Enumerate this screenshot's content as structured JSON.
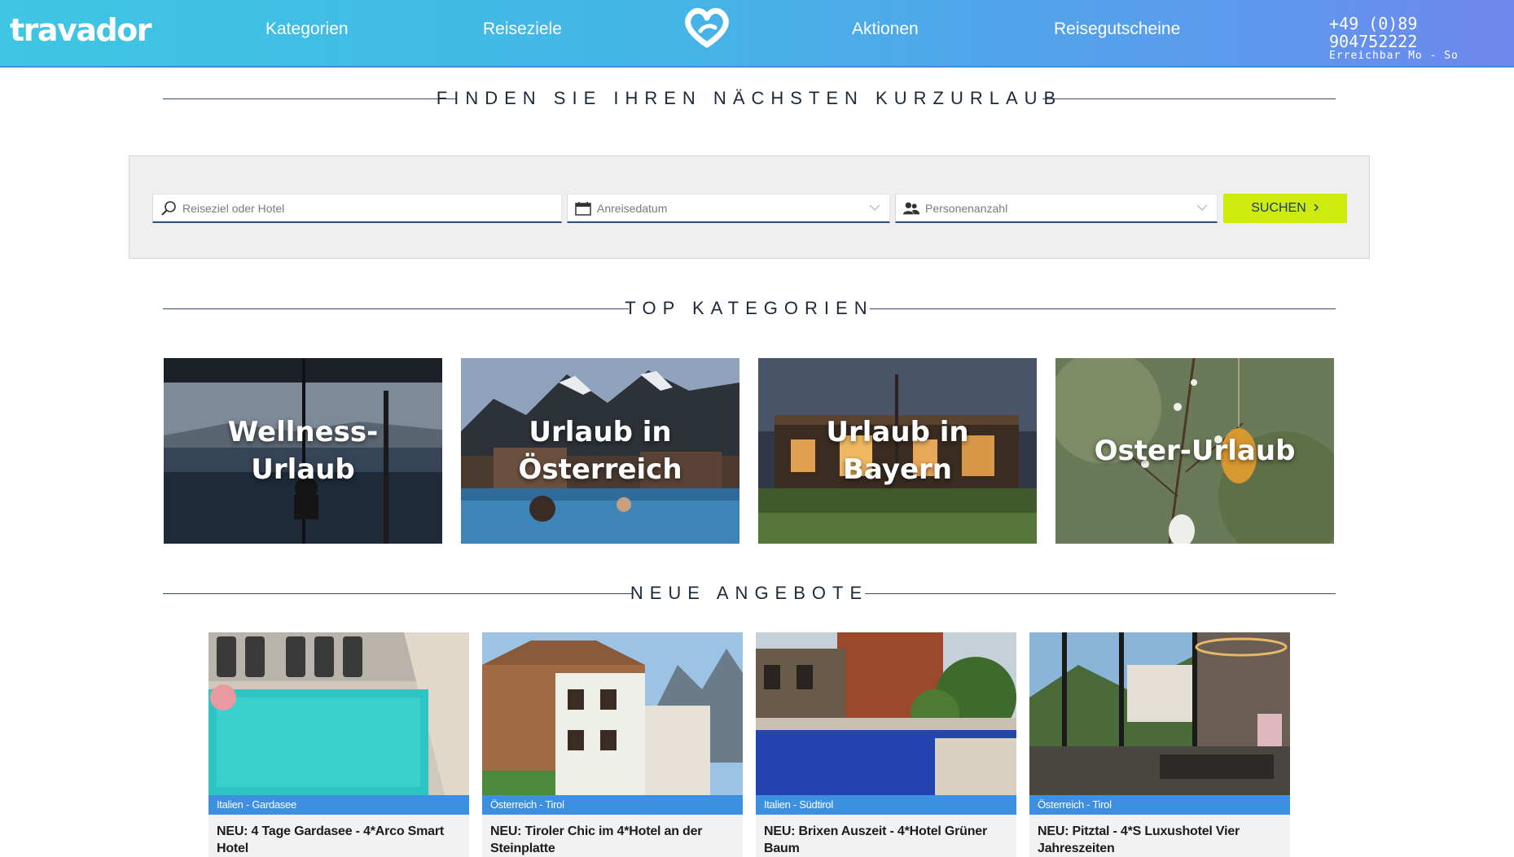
{
  "header": {
    "logo": "travador",
    "nav": [
      "Kategorien",
      "Reiseziele",
      "Aktionen",
      "Reisegutscheine"
    ],
    "phone": "+49 (0)89 904752222",
    "hours": "Erreichbar Mo - So"
  },
  "search_section": {
    "heading": "FINDEN SIE IHREN NÄCHSTEN KURZURLAUB",
    "destination_placeholder": "Reiseziel oder Hotel",
    "date_placeholder": "Anreisedatum",
    "persons_placeholder": "Personenanzahl",
    "search_label": "SUCHEN"
  },
  "categories": {
    "heading": "TOP KATEGORIEN",
    "items": [
      {
        "label": "Wellness-Urlaub"
      },
      {
        "label": "Urlaub in Österreich"
      },
      {
        "label": "Urlaub in Bayern"
      },
      {
        "label": "Oster-Urlaub"
      }
    ]
  },
  "offers": {
    "heading": "NEUE ANGEBOTE",
    "items": [
      {
        "region": "Italien - Gardasee",
        "title": "NEU: 4 Tage Gardasee - 4*Arco Smart Hotel"
      },
      {
        "region": "Österreich - Tirol",
        "title": "NEU: Tiroler Chic im 4*Hotel an der Steinplatte"
      },
      {
        "region": "Italien - Südtirol",
        "title": "NEU: Brixen Auszeit - 4*Hotel Grüner Baum"
      },
      {
        "region": "Österreich - Tirol",
        "title": "NEU: Pitztal - 4*S Luxushotel Vier Jahreszeiten"
      }
    ]
  },
  "colors": {
    "accent_button": "#cdeb0f",
    "region_band": "#3d8fdf",
    "header_gradient_start": "#3ec6e4",
    "header_gradient_end": "#6f87ee"
  }
}
